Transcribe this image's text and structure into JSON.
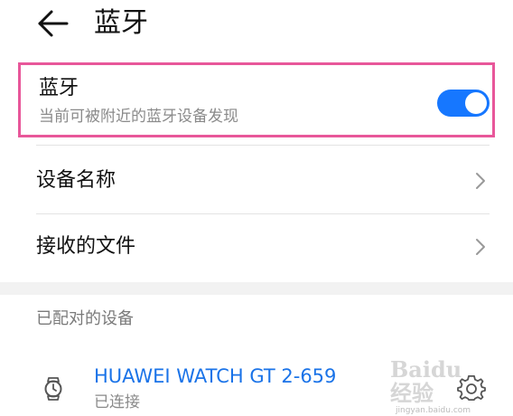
{
  "header": {
    "title": "蓝牙",
    "back_icon": "arrow-left-icon"
  },
  "bluetooth": {
    "title": "蓝牙",
    "subtitle": "当前可被附近的蓝牙设备发现",
    "enabled": true,
    "toggle_color": "#1677ff",
    "highlight_color": "#e8579a"
  },
  "menu": {
    "device_name_label": "设备名称",
    "received_files_label": "接收的文件"
  },
  "paired": {
    "section_label": "已配对的设备",
    "devices": [
      {
        "name": "HUAWEI WATCH GT 2-659",
        "status": "已连接",
        "icon": "watch-icon",
        "name_color": "#1a73e8"
      }
    ]
  },
  "watermark": {
    "text": "Baidu 经验",
    "subtext": "jingyan.baidu.com"
  }
}
